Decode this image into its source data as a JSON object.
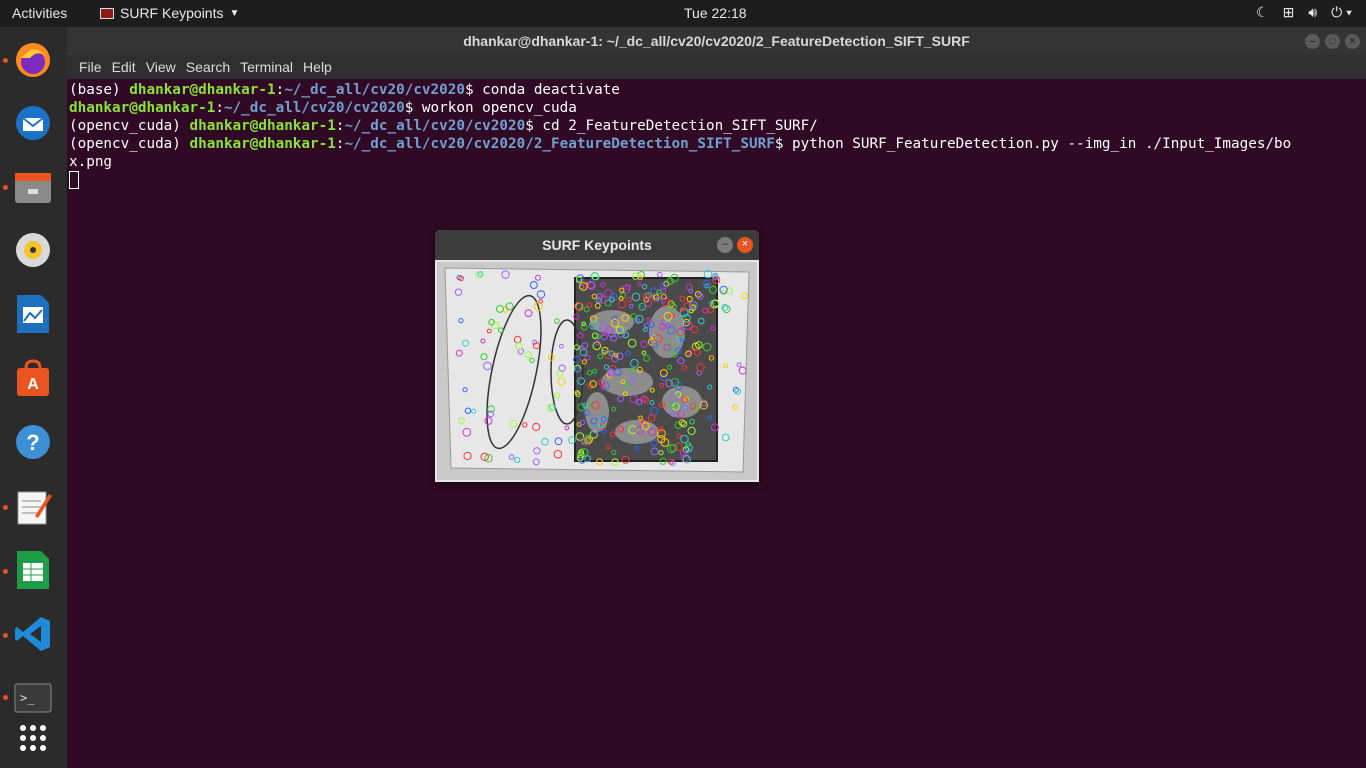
{
  "topbar": {
    "activities": "Activities",
    "app_name": "SURF Keypoints",
    "clock": "Tue 22:18",
    "tray_icons": [
      "night-light-icon",
      "network-icon",
      "volume-icon",
      "power-icon"
    ]
  },
  "dock": {
    "items": [
      {
        "name": "firefox",
        "running": true
      },
      {
        "name": "thunderbird",
        "running": false
      },
      {
        "name": "files",
        "running": true
      },
      {
        "name": "rhythmbox",
        "running": false
      },
      {
        "name": "libreoffice-writer",
        "running": false
      },
      {
        "name": "ubuntu-software",
        "running": false
      },
      {
        "name": "help",
        "running": false
      },
      {
        "name": "text-editor",
        "running": true
      },
      {
        "name": "libreoffice-calc",
        "running": true
      },
      {
        "name": "vscode",
        "running": true
      },
      {
        "name": "terminal",
        "running": true
      },
      {
        "name": "show-applications",
        "running": false
      }
    ]
  },
  "terminal": {
    "title": "dhankar@dhankar-1: ~/_dc_all/cv20/cv2020/2_FeatureDetection_SIFT_SURF",
    "menu": [
      "File",
      "Edit",
      "View",
      "Search",
      "Terminal",
      "Help"
    ],
    "lines": [
      {
        "env": "(base) ",
        "user": "dhankar@dhankar-1",
        "path": "~/_dc_all/cv20/cv2020",
        "cmd": "$ conda deactivate"
      },
      {
        "env": "",
        "user": "dhankar@dhankar-1",
        "path": "~/_dc_all/cv20/cv2020",
        "cmd": "$ workon opencv_cuda"
      },
      {
        "env": "(opencv_cuda) ",
        "user": "dhankar@dhankar-1",
        "path": "~/_dc_all/cv20/cv2020",
        "cmd": "$ cd 2_FeatureDetection_SIFT_SURF/"
      },
      {
        "env": "(opencv_cuda) ",
        "user": "dhankar@dhankar-1",
        "path": "~/_dc_all/cv20/cv2020/2_FeatureDetection_SIFT_SURF",
        "cmd": "$ python SURF_FeatureDetection.py --img_in ./Input_Images/bo"
      }
    ],
    "wrap_line": "x.png"
  },
  "popup": {
    "title": "SURF Keypoints"
  }
}
